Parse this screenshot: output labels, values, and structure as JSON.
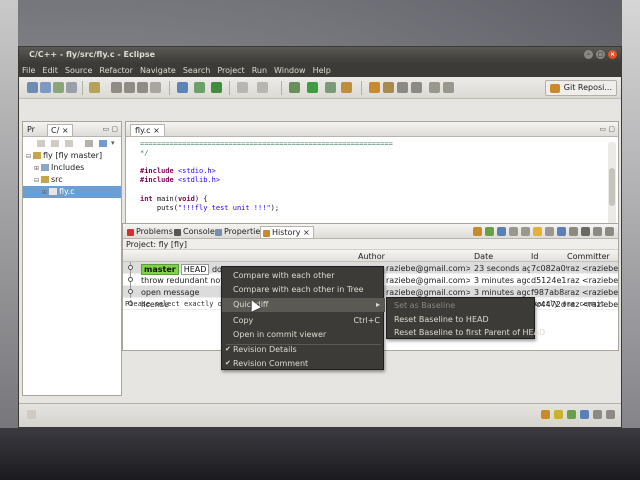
{
  "window": {
    "title": "C/C++ - fly/src/fly.c - Eclipse"
  },
  "menubar": [
    "File",
    "Edit",
    "Source",
    "Refactor",
    "Navigate",
    "Search",
    "Project",
    "Run",
    "Window",
    "Help"
  ],
  "toolbar": {
    "perspective_label": "Git Reposi..."
  },
  "package_explorer": {
    "tabs": [
      "Pr",
      "C/"
    ],
    "tree": [
      {
        "label": "fly [fly master]",
        "depth": 0,
        "expanded": true
      },
      {
        "label": "Includes",
        "depth": 1,
        "expanded": false
      },
      {
        "label": "src",
        "depth": 1,
        "expanded": true
      },
      {
        "label": "fly.c",
        "depth": 2,
        "expanded": false,
        "selected": true
      }
    ]
  },
  "editor": {
    "tab_label": "fly.c",
    "code": {
      "l1": "============================================================",
      "l2": "*/",
      "l3a": "#include",
      "l3b": " <stdio.h>",
      "l4a": "#include",
      "l4b": " <stdlib.h>",
      "l5a": "int",
      "l5b": " main(",
      "l5c": "void",
      "l5d": ") {",
      "l6a": "    puts(",
      "l6b": "\"!!!fly test unit !!!\"",
      "l6c": ");"
    }
  },
  "views": {
    "tabs": [
      "Problems",
      "Console",
      "Properties",
      "History"
    ],
    "active_tab": "History",
    "project_line": "Project: fly [fly]",
    "columns": {
      "author": "Author",
      "date": "Date",
      "id": "Id",
      "committer": "Committer"
    },
    "rows": [
      {
        "branch": "master",
        "head": "HEAD",
        "message": "don't i",
        "author": "raziebe@gmail.com>",
        "date": "23 seconds ago",
        "id": "7c082a09",
        "committer": "raz <raziebe@"
      },
      {
        "message": "throw redundant note",
        "author": "raziebe@gmail.com>",
        "date": "3 minutes ago",
        "id": "d5124e11",
        "committer": "raz <raziebe@"
      },
      {
        "message": "open message",
        "author": "raziebe@gmail.com>",
        "date": "3 minutes ago",
        "id": "f987ab8a",
        "committer": "raz <raziebe@"
      },
      {
        "message": "license",
        "author": "",
        "date": "",
        "id": "9c4472d",
        "committer": "raz <raziebe@"
      }
    ],
    "detail_left": "Please select exactly o",
    "detail_right": "xactly one commit"
  },
  "context_menu": {
    "items": [
      {
        "label": "Compare with each other",
        "accel": ""
      },
      {
        "label": "Compare with each other in Tree",
        "accel": ""
      },
      {
        "label": "Quickdiff",
        "accel": "",
        "submenu": true
      },
      {
        "label": "Copy",
        "accel": "Ctrl+C"
      },
      {
        "label": "Open in commit viewer",
        "accel": ""
      },
      {
        "label": "Revision Details",
        "accel": "",
        "checked": true
      },
      {
        "label": "Revision Comment",
        "accel": "",
        "checked": true
      }
    ],
    "submenu": [
      {
        "label": "Set as Baseline",
        "disabled": true
      },
      {
        "label": "Reset Baseline to HEAD"
      },
      {
        "label": "Reset Baseline to first Parent of HEAD"
      }
    ]
  }
}
